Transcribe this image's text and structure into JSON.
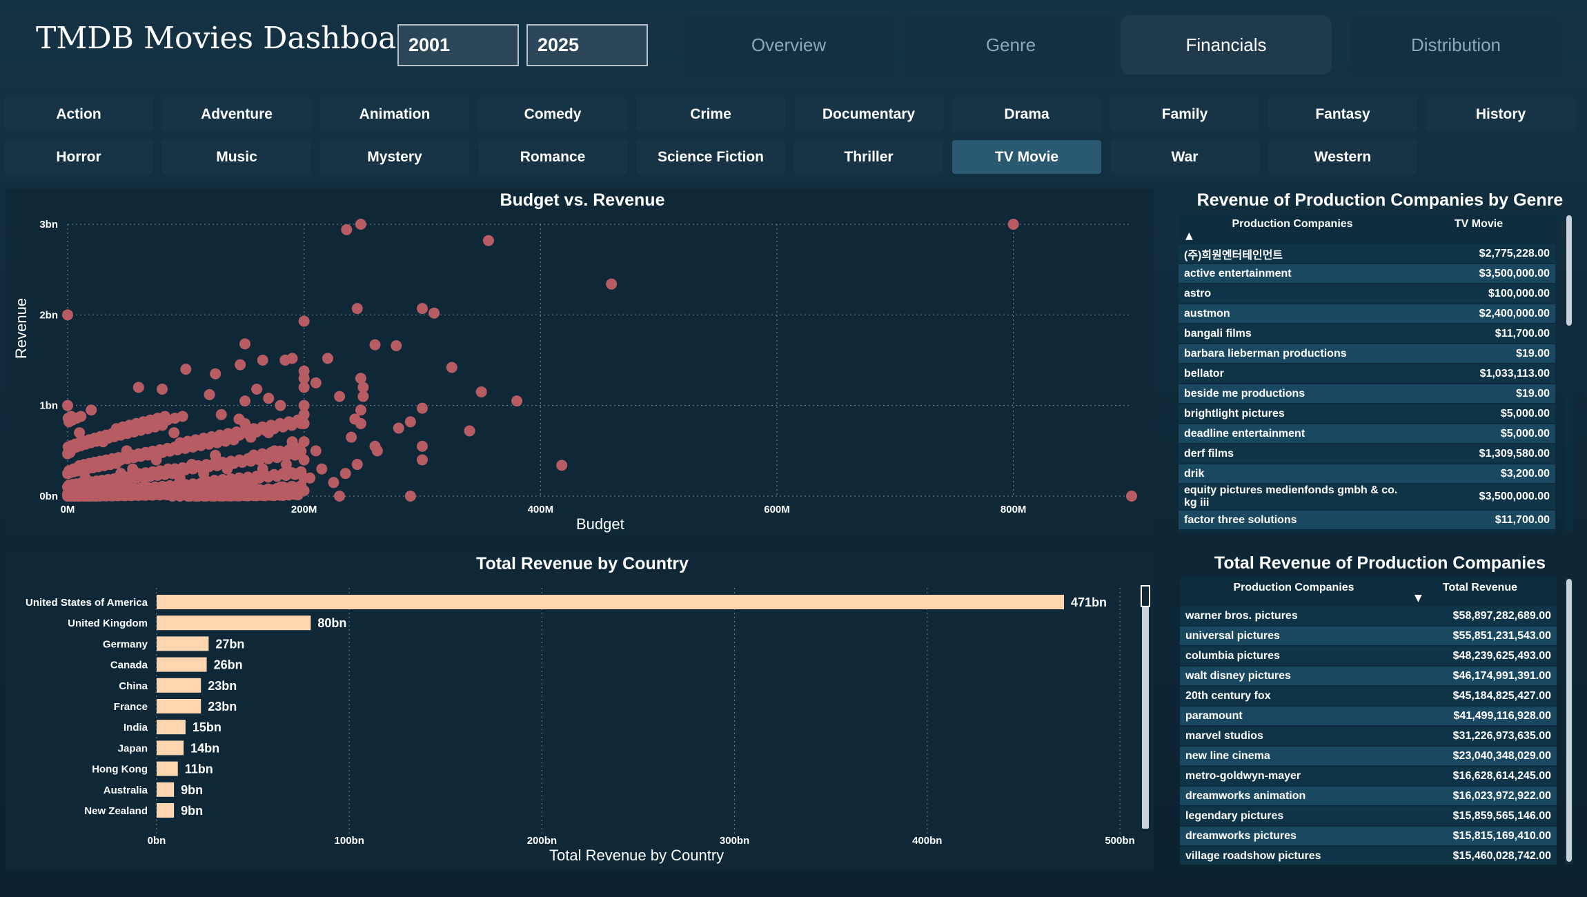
{
  "app": {
    "title": "TMDB Movies Dashboard"
  },
  "year_range": {
    "start": "2001",
    "end": "2025"
  },
  "nav_tabs": [
    {
      "label": "Overview",
      "active": false
    },
    {
      "label": "Genre",
      "active": false
    },
    {
      "label": "Financials",
      "active": true
    },
    {
      "label": "Distribution",
      "active": false
    }
  ],
  "genres": [
    {
      "label": "Action"
    },
    {
      "label": "Adventure"
    },
    {
      "label": "Animation"
    },
    {
      "label": "Comedy"
    },
    {
      "label": "Crime"
    },
    {
      "label": "Documentary"
    },
    {
      "label": "Drama"
    },
    {
      "label": "Family"
    },
    {
      "label": "Fantasy"
    },
    {
      "label": "History"
    },
    {
      "label": "Horror"
    },
    {
      "label": "Music"
    },
    {
      "label": "Mystery"
    },
    {
      "label": "Romance"
    },
    {
      "label": "Science Fiction"
    },
    {
      "label": "Thriller"
    },
    {
      "label": "TV Movie",
      "active": true
    },
    {
      "label": "War"
    },
    {
      "label": "Western"
    }
  ],
  "colors": {
    "scatter": "#b85c64",
    "bar": "#fdd6b0",
    "accent": "#2a5a72"
  },
  "scatter_chart": {
    "title": "Budget vs. Revenue",
    "xlabel": "Budget",
    "ylabel": "Revenue",
    "xticks": [
      "0M",
      "200M",
      "400M",
      "600M",
      "800M"
    ],
    "yticks": [
      "0bn",
      "1bn",
      "2bn",
      "3bn"
    ]
  },
  "bar_chart": {
    "title": "Total Revenue by Country",
    "xlabel": "Total Revenue by Country",
    "xticks": [
      "0bn",
      "100bn",
      "200bn",
      "300bn",
      "400bn",
      "500bn"
    ]
  },
  "genre_table": {
    "title": "Revenue of Production Companies by Genre",
    "col1": "Production Companies",
    "col2": "TV Movie",
    "rows": [
      {
        "name": "(주)희원엔터테인먼트",
        "value": "$2,775,228.00"
      },
      {
        "name": "active entertainment",
        "value": "$3,500,000.00"
      },
      {
        "name": "astro",
        "value": "$100,000.00"
      },
      {
        "name": "austmon",
        "value": "$2,400,000.00"
      },
      {
        "name": "bangali films",
        "value": "$11,700.00"
      },
      {
        "name": "barbara lieberman productions",
        "value": "$19.00"
      },
      {
        "name": "bellator",
        "value": "$1,033,113.00"
      },
      {
        "name": "beside me productions",
        "value": "$19.00"
      },
      {
        "name": "brightlight pictures",
        "value": "$5,000.00"
      },
      {
        "name": "deadline entertainment",
        "value": "$5,000.00"
      },
      {
        "name": "derf films",
        "value": "$1,309,580.00"
      },
      {
        "name": "drik",
        "value": "$3,200.00"
      },
      {
        "name": "equity pictures medienfonds gmbh & co. kg iii",
        "value": "$3,500,000.00"
      },
      {
        "name": "factor three solutions",
        "value": "$11,700.00"
      }
    ]
  },
  "total_table": {
    "title": "Total Revenue of Production Companies",
    "col1": "Production Companies",
    "col2": "Total Revenue",
    "rows": [
      {
        "name": "warner bros. pictures",
        "value": "$58,897,282,689.00"
      },
      {
        "name": "universal pictures",
        "value": "$55,851,231,543.00"
      },
      {
        "name": "columbia pictures",
        "value": "$48,239,625,493.00"
      },
      {
        "name": "walt disney pictures",
        "value": "$46,174,991,391.00"
      },
      {
        "name": "20th century fox",
        "value": "$45,184,825,427.00"
      },
      {
        "name": "paramount",
        "value": "$41,499,116,928.00"
      },
      {
        "name": "marvel studios",
        "value": "$31,226,973,635.00"
      },
      {
        "name": "new line cinema",
        "value": "$23,040,348,029.00"
      },
      {
        "name": "metro-goldwyn-mayer",
        "value": "$16,628,614,245.00"
      },
      {
        "name": "dreamworks animation",
        "value": "$16,023,972,922.00"
      },
      {
        "name": "legendary pictures",
        "value": "$15,859,565,146.00"
      },
      {
        "name": "dreamworks pictures",
        "value": "$15,815,169,410.00"
      },
      {
        "name": "village roadshow pictures",
        "value": "$15,460,028,742.00"
      }
    ]
  },
  "chart_data": [
    {
      "type": "scatter",
      "title": "Budget vs. Revenue",
      "xlabel": "Budget",
      "ylabel": "Revenue",
      "xlim": [
        0,
        900
      ],
      "ylim": [
        0,
        3
      ],
      "grid": true,
      "points": [
        [
          236,
          2.94
        ],
        [
          248,
          3.0
        ],
        [
          356,
          2.82
        ],
        [
          800,
          3.0
        ],
        [
          460,
          2.34
        ],
        [
          0,
          2.0
        ],
        [
          200,
          1.93
        ],
        [
          245,
          2.07
        ],
        [
          300,
          2.07
        ],
        [
          310,
          2.02
        ],
        [
          150,
          1.68
        ],
        [
          260,
          1.67
        ],
        [
          278,
          1.66
        ],
        [
          220,
          1.52
        ],
        [
          146,
          1.45
        ],
        [
          165,
          1.5
        ],
        [
          184,
          1.5
        ],
        [
          190,
          1.52
        ],
        [
          325,
          1.42
        ],
        [
          100,
          1.4
        ],
        [
          125,
          1.35
        ],
        [
          200,
          1.38
        ],
        [
          210,
          1.25
        ],
        [
          250,
          1.2
        ],
        [
          250,
          1.1
        ],
        [
          350,
          1.15
        ],
        [
          380,
          1.05
        ],
        [
          300,
          0.97
        ],
        [
          0,
          1.0
        ],
        [
          20,
          0.95
        ],
        [
          60,
          1.2
        ],
        [
          80,
          1.18
        ],
        [
          120,
          1.12
        ],
        [
          160,
          1.18
        ],
        [
          170,
          1.08
        ],
        [
          230,
          1.1
        ],
        [
          290,
          0.82
        ],
        [
          340,
          0.72
        ],
        [
          262,
          0.5
        ],
        [
          300,
          0.4
        ],
        [
          418,
          0.34
        ],
        [
          230,
          0.0
        ],
        [
          290,
          0.0
        ],
        [
          900,
          0.0
        ],
        [
          10,
          0.7
        ],
        [
          30,
          0.6
        ],
        [
          50,
          0.5
        ],
        [
          70,
          0.8
        ],
        [
          90,
          0.7
        ],
        [
          110,
          0.6
        ],
        [
          130,
          0.9
        ],
        [
          150,
          0.8
        ],
        [
          170,
          0.7
        ],
        [
          190,
          0.6
        ],
        [
          210,
          0.5
        ],
        [
          240,
          0.65
        ],
        [
          260,
          0.55
        ],
        [
          280,
          0.75
        ],
        [
          200,
          0.9
        ],
        [
          180,
          1.0
        ],
        [
          5,
          0.3
        ],
        [
          15,
          0.2
        ],
        [
          25,
          0.35
        ],
        [
          35,
          0.15
        ],
        [
          45,
          0.25
        ],
        [
          55,
          0.3
        ],
        [
          65,
          0.2
        ],
        [
          75,
          0.4
        ],
        [
          85,
          0.3
        ],
        [
          95,
          0.2
        ],
        [
          105,
          0.35
        ],
        [
          115,
          0.25
        ],
        [
          125,
          0.45
        ],
        [
          135,
          0.3
        ],
        [
          145,
          0.2
        ],
        [
          155,
          0.4
        ],
        [
          165,
          0.3
        ],
        [
          175,
          0.5
        ],
        [
          185,
          0.35
        ],
        [
          195,
          0.25
        ],
        [
          205,
          0.2
        ],
        [
          215,
          0.3
        ],
        [
          225,
          0.15
        ],
        [
          235,
          0.25
        ],
        [
          245,
          0.35
        ],
        [
          20,
          0.05
        ],
        [
          40,
          0.08
        ],
        [
          60,
          0.05
        ],
        [
          80,
          0.1
        ],
        [
          100,
          0.06
        ],
        [
          120,
          0.04
        ],
        [
          140,
          0.08
        ],
        [
          160,
          0.05
        ],
        [
          180,
          0.1
        ],
        [
          200,
          0.06
        ],
        [
          200,
          0.2
        ],
        [
          200,
          0.4
        ],
        [
          200,
          0.6
        ],
        [
          200,
          0.8
        ],
        [
          200,
          1.0
        ],
        [
          200,
          1.2
        ],
        [
          200,
          1.3
        ],
        [
          150,
          1.05
        ],
        [
          145,
          0.85
        ],
        [
          155,
          0.65
        ],
        [
          248,
          0.95
        ],
        [
          248,
          1.3
        ],
        [
          248,
          0.8
        ],
        [
          243,
          0.85
        ],
        [
          300,
          0.55
        ]
      ]
    },
    {
      "type": "bar",
      "orientation": "horizontal",
      "title": "Total Revenue by Country",
      "xlabel": "Total Revenue by Country",
      "xlim": [
        0,
        500
      ],
      "categories": [
        "United States of America",
        "United Kingdom",
        "Germany",
        "Canada",
        "China",
        "France",
        "India",
        "Japan",
        "Hong Kong",
        "Australia",
        "New Zealand"
      ],
      "values": [
        471,
        80,
        27,
        26,
        23,
        23,
        15,
        14,
        11,
        9,
        9
      ],
      "data_labels": [
        "471bn",
        "80bn",
        "27bn",
        "26bn",
        "23bn",
        "23bn",
        "15bn",
        "14bn",
        "11bn",
        "9bn",
        "9bn"
      ]
    }
  ]
}
